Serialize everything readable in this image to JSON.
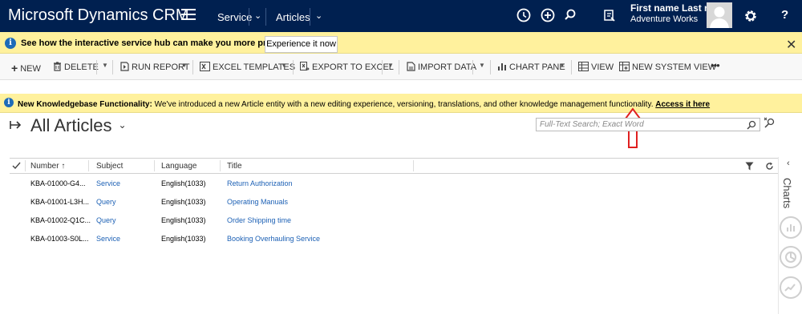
{
  "navbar": {
    "app_title": "Microsoft Dynamics CRM",
    "area": "Service",
    "entity": "Articles",
    "user_name": "First name Last na...",
    "org_name": "Adventure Works",
    "help": "?"
  },
  "hub_banner": {
    "icon_text": "i",
    "message": "See how the interactive service hub can make you more productive.",
    "button": "Experience it now",
    "close": "✕"
  },
  "commands": {
    "new": "NEW",
    "delete": "DELETE",
    "run_report": "RUN REPORT",
    "excel_templates": "EXCEL TEMPLATES",
    "export_excel": "EXPORT TO EXCEL",
    "import_data": "IMPORT DATA",
    "chart_pane": "CHART PANE",
    "view": "VIEW",
    "new_system_view": "NEW SYSTEM VIEW",
    "more": "•••"
  },
  "kb_banner": {
    "icon_text": "i",
    "bold": "New Knowledgebase Functionality:",
    "message": " We've introduced a new Article entity with a new editing experience, versioning, translations, and other knowledge management functionality. ",
    "link": "Access it here"
  },
  "view": {
    "title": "All Articles",
    "search_placeholder": "Full-Text Search; Exact Word"
  },
  "grid": {
    "columns": [
      "Number ↑",
      "Subject",
      "Language",
      "Title"
    ],
    "rows": [
      {
        "number": "KBA-01000-G4...",
        "subject": "Service",
        "language": "English(1033)",
        "title": "Return Authorization"
      },
      {
        "number": "KBA-01001-L3H...",
        "subject": "Query",
        "language": "English(1033)",
        "title": "Operating Manuals"
      },
      {
        "number": "KBA-01002-Q1C...",
        "subject": "Query",
        "language": "English(1033)",
        "title": "Order Shipping time"
      },
      {
        "number": "KBA-01003-S0L...",
        "subject": "Service",
        "language": "English(1033)",
        "title": "Booking Overhauling Service"
      }
    ]
  },
  "rail": {
    "label": "Charts"
  },
  "colors": {
    "nav_bg": "#002050",
    "banner_bg": "#fff19d",
    "link": "#1d61b5",
    "annotation_arrow": "#e02020"
  }
}
